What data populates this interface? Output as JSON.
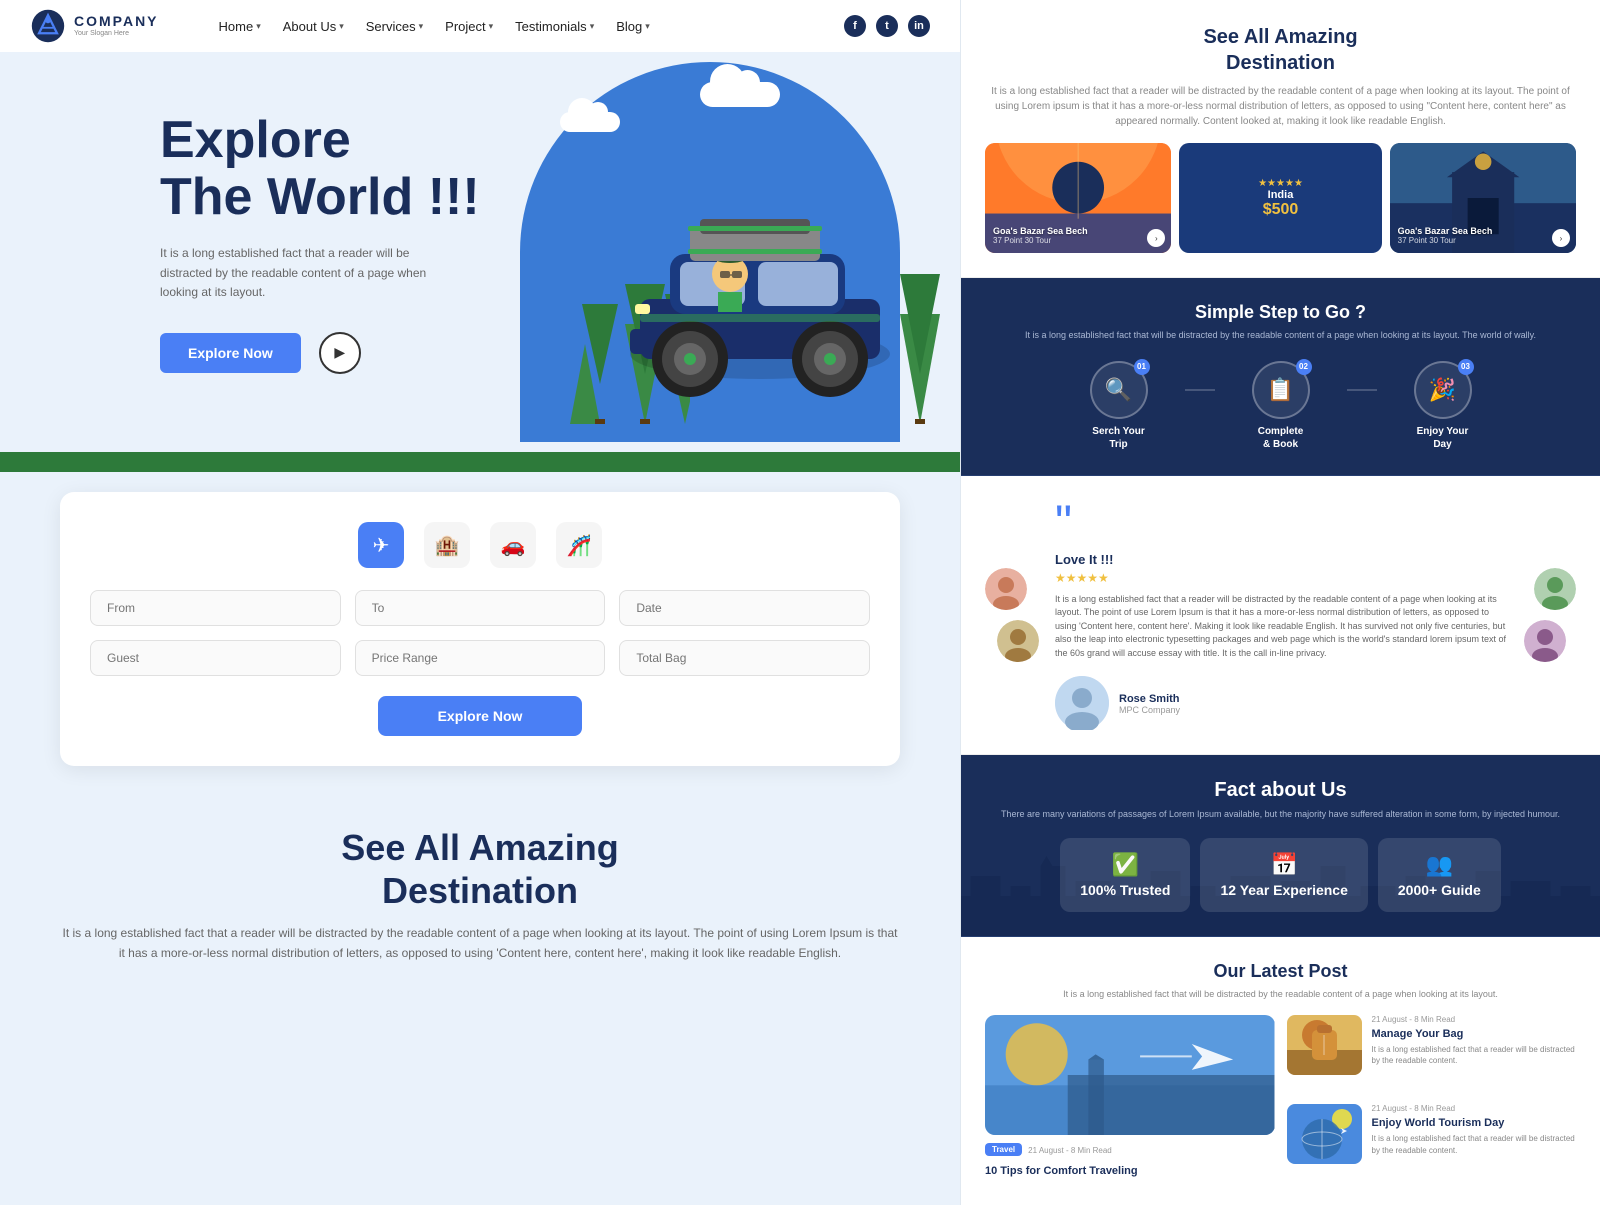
{
  "company": {
    "name": "COMPANY",
    "tagline": "Your Slogan Here"
  },
  "navbar": {
    "links": [
      "Home",
      "About Us",
      "Services",
      "Project",
      "Testimonials",
      "Blog"
    ],
    "social": [
      "f",
      "t",
      "in"
    ]
  },
  "hero": {
    "title_line1": "Explore",
    "title_line2": "The World !!!",
    "description": "It is a long established fact that a reader will be distracted by the readable content of a page when looking at its layout.",
    "btn_explore": "Explore Now"
  },
  "search": {
    "tabs": [
      "✈",
      "🏨",
      "🚗",
      "🎢"
    ],
    "fields": {
      "from": "From",
      "to": "To",
      "date": "Date",
      "guest": "Guest",
      "price": "Price Range",
      "bag": "Total Bag"
    },
    "btn": "Explore Now"
  },
  "destination": {
    "title_line1": "See All Amazing",
    "title_line2": "Destination",
    "description": "It is a long established fact that a reader will be distracted by the readable content of a page when looking at its layout. The point of using Lorem Ipsum is that it has a more-or-less normal distribution of letters, as opposed to using 'Content here, content here', making it look like readable English."
  },
  "right_destination": {
    "title": "See All Amazing\nDestination",
    "description": "It is a long established fact that a reader will be distracted by the readable content of a page when looking at its layout. The point of using Lorem ipsum is that it has a more-or-less normal distribution of letters, as opposed to using \"Content here, content here\" as appeared normally. Content looked at, making it look like readable English.",
    "cards": [
      {
        "label": "Goa's Bazar Sea Bech",
        "sub": "37 Point  30 Tour"
      },
      {
        "label": "India",
        "price": "$500",
        "stars": "★★★★★"
      },
      {
        "label": "Goa's Bazar Sea Bech",
        "sub": "37 Point  30 Tour"
      }
    ]
  },
  "simple_step": {
    "title": "Simple Step to Go ?",
    "description": "It is a long established fact that will be distracted by the readable content of a page when looking at its layout. The world of wally.",
    "steps": [
      {
        "num": "01",
        "icon": "🔍",
        "label": "Serch Your\nTrip"
      },
      {
        "num": "02",
        "icon": "📋",
        "label": "Complete\n& Book"
      },
      {
        "num": "03",
        "icon": "🎉",
        "label": "Enjoy Your\nDay"
      }
    ]
  },
  "testimonial": {
    "love_it": "Love It !!!",
    "stars": "★★★★★",
    "review": "It is a long established fact that a reader will be distracted by the readable content of a page when looking at its layout. The point of use Lorem Ipsum is that it has a more-or-less normal distribution of letters, as opposed to using 'Content here, content here'. Making it look like readable English. It has survived not only five centuries, but also the leap into electronic typesetting packages and web page which is the world's standard lorem ipsum text of the 60s grand will accuse essay with title. It is the call in-line privacy.",
    "name": "Rose Smith",
    "title": "MPC Company"
  },
  "fact": {
    "title": "Fact about Us",
    "description": "There are many variations of passages of Lorem Ipsum available, but the majority have suffered alteration in some form, by injected humour.",
    "cards": [
      {
        "icon": "✅",
        "value": "100% Trusted",
        "label": ""
      },
      {
        "icon": "📅",
        "value": "12 Year Experience",
        "label": ""
      },
      {
        "icon": "👥",
        "value": "2000+ Guide",
        "label": ""
      }
    ]
  },
  "latest_post": {
    "title": "Our Latest Post",
    "description": "It is a long established fact that will be distracted by the readable content of a page when looking at its layout.",
    "posts": [
      {
        "date": "10 Tips for Comfort Traveling",
        "badge_color": "#4a7ff5",
        "badge_text": "Travel",
        "desc": ""
      },
      {
        "date": "Manage Your Bag",
        "sub_date": "21 August - 8 Min Read",
        "desc": "It is a long established fact that a reader will be distracted by the readable content."
      },
      {
        "date": "Enjoy World Tourism Day",
        "sub_date": "21 August - 8 Min Read",
        "desc": "It is a long established fact that a reader will be distracted by the readable content."
      }
    ]
  },
  "colors": {
    "primary": "#4a7ff5",
    "dark": "#1a2e5a",
    "green": "#2d7a3a",
    "hero_bg": "#eaf2fb",
    "blue_circle": "#3a7bd5"
  }
}
